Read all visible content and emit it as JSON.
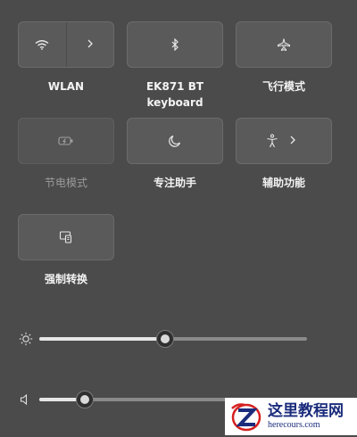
{
  "tiles": {
    "wlan": {
      "label": "WLAN",
      "icon": "wifi-icon"
    },
    "bluetooth": {
      "label_line1": "EK871 BT",
      "label_line2": "keyboard",
      "icon": "bluetooth-icon"
    },
    "airplane": {
      "label": "飞行模式",
      "icon": "airplane-icon"
    },
    "battery_saver": {
      "label": "节电模式",
      "icon": "battery-saver-icon",
      "disabled": true
    },
    "focus": {
      "label": "专注助手",
      "icon": "moon-icon"
    },
    "accessibility": {
      "label": "辅助功能",
      "icon": "accessibility-icon"
    },
    "project": {
      "label": "强制转换",
      "icon": "cast-icon"
    }
  },
  "sliders": {
    "brightness": {
      "icon": "brightness-icon",
      "value": 0.47
    },
    "volume": {
      "icon": "speaker-icon",
      "value": 0.17
    }
  },
  "watermark": {
    "title": "这里教程网",
    "url": "herecours.com",
    "icon": "logo-z-icon"
  },
  "colors": {
    "panel_bg": "#4b4b4b",
    "tile_bg": "#5a5a5a",
    "watermark_text": "#1b2c7c",
    "watermark_accent": "#d62020"
  }
}
